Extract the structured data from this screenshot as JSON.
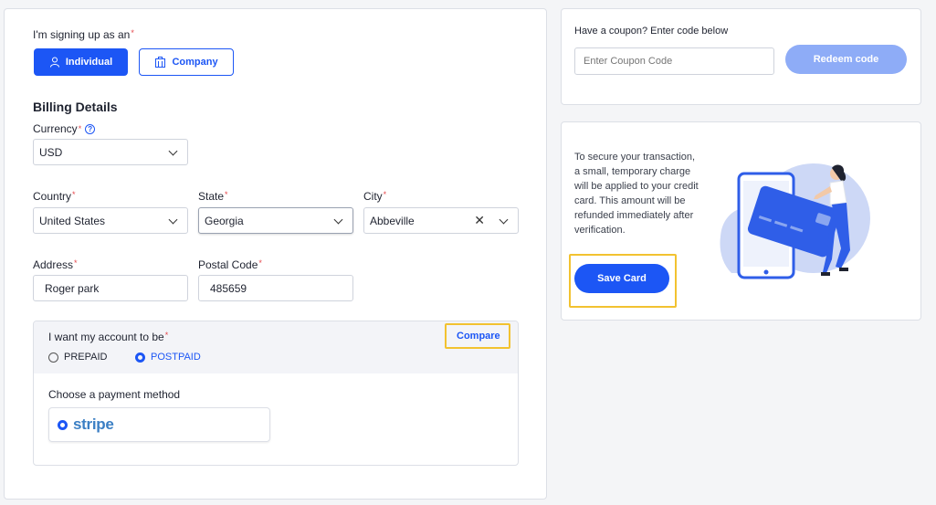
{
  "signup": {
    "label": "I'm signing up as an",
    "options": [
      {
        "label": "Individual",
        "selected": true
      },
      {
        "label": "Company",
        "selected": false
      }
    ]
  },
  "billing": {
    "title": "Billing Details",
    "currency": {
      "label": "Currency",
      "value": "USD"
    },
    "country": {
      "label": "Country",
      "value": "United States"
    },
    "state": {
      "label": "State",
      "value": "Georgia"
    },
    "city": {
      "label": "City",
      "value": "Abbeville"
    },
    "address": {
      "label": "Address",
      "value": "Roger park"
    },
    "postal": {
      "label": "Postal Code",
      "value": "485659"
    }
  },
  "account": {
    "label": "I want my account to be",
    "compare_label": "Compare",
    "options": [
      {
        "label": "PREPAID",
        "selected": false
      },
      {
        "label": "POSTPAID",
        "selected": true
      }
    ],
    "payment_label": "Choose a payment method",
    "payment_option": "stripe"
  },
  "coupon": {
    "label": "Have a coupon? Enter code below",
    "placeholder": "Enter Coupon Code",
    "redeem_label": "Redeem code"
  },
  "card": {
    "info": "To secure your transaction, a small, temporary charge will be applied to your credit card. This amount will be refunded immediately after verification.",
    "save_label": "Save Card"
  },
  "colors": {
    "primary": "#1c56f5",
    "primary_disabled": "#8eacf7",
    "required": "#e5484d",
    "highlight": "#f2c230"
  }
}
